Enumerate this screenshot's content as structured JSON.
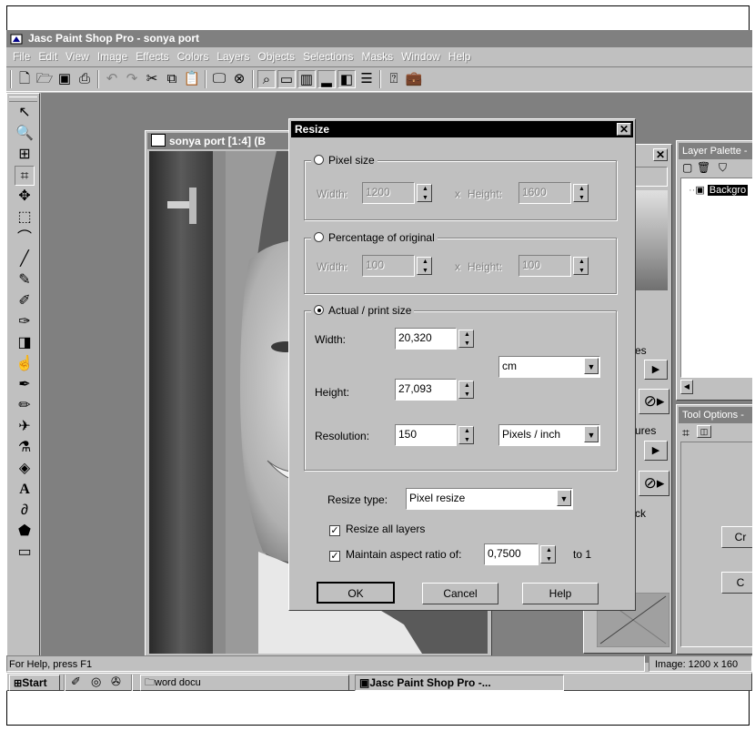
{
  "app": {
    "title": "Jasc Paint Shop Pro - sonya port",
    "menu": [
      "File",
      "Edit",
      "View",
      "Image",
      "Effects",
      "Colors",
      "Layers",
      "Objects",
      "Selections",
      "Masks",
      "Window",
      "Help"
    ]
  },
  "image_window": {
    "title": "sonya port [1:4] (B"
  },
  "layer_palette": {
    "title": "Layer Palette -",
    "layer_name": "Backgro"
  },
  "tool_options": {
    "title": "Tool Options -",
    "crop_button": "Cr",
    "button2": "C"
  },
  "side_labels": {
    "l1": "es",
    "l2": "ures",
    "l3": "ck"
  },
  "dialog": {
    "title": "Resize",
    "pixel_size": {
      "label": "Pixel size",
      "width_label": "Width:",
      "width_value": "1200",
      "height_label": "Height:",
      "height_value": "1600",
      "x": "x"
    },
    "percentage": {
      "label": "Percentage of original",
      "width_label": "Width:",
      "width_value": "100",
      "height_label": "Height:",
      "height_value": "100",
      "x": "x"
    },
    "actual": {
      "label": "Actual / print size",
      "width_label": "Width:",
      "width_value": "20,320",
      "height_label": "Height:",
      "height_value": "27,093",
      "unit": "cm",
      "resolution_label": "Resolution:",
      "resolution_value": "150",
      "resolution_unit": "Pixels / inch"
    },
    "resize_type_label": "Resize type:",
    "resize_type_value": "Pixel resize",
    "resize_all_layers": "Resize all layers",
    "maintain_aspect": "Maintain aspect ratio of:",
    "aspect_value": "0,7500",
    "to1": "to 1",
    "ok": "OK",
    "cancel": "Cancel",
    "help": "Help"
  },
  "status": {
    "help": "For Help, press F1",
    "image_info": "Image:  1200 x 160"
  },
  "taskbar": {
    "start": "Start",
    "tasks": [
      "word docu",
      "Jasc Paint Shop Pro -..."
    ]
  }
}
